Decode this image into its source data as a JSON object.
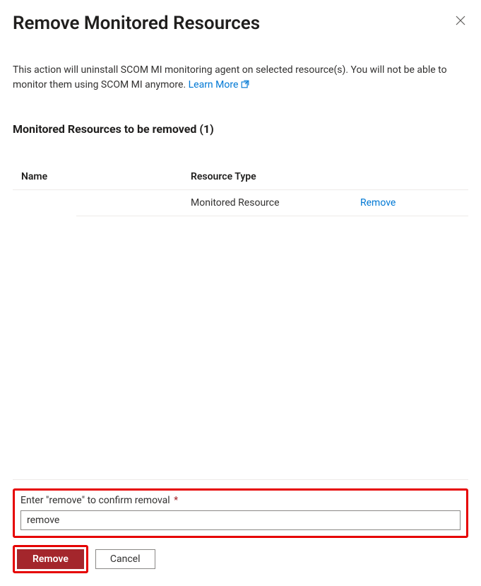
{
  "dialog": {
    "title": "Remove Monitored Resources",
    "description_text": "This action will uninstall SCOM MI monitoring agent on selected resource(s). You will not be able to monitor them using SCOM MI anymore. ",
    "learn_more_label": "Learn More"
  },
  "resources_section": {
    "heading": "Monitored Resources to be removed (1)",
    "columns": {
      "name": "Name",
      "type": "Resource Type"
    },
    "rows": [
      {
        "name": "",
        "type": "Monitored Resource",
        "action_label": "Remove"
      }
    ]
  },
  "confirm": {
    "label": "Enter \"remove\" to confirm removal",
    "value": "remove"
  },
  "buttons": {
    "primary": "Remove",
    "secondary": "Cancel"
  }
}
